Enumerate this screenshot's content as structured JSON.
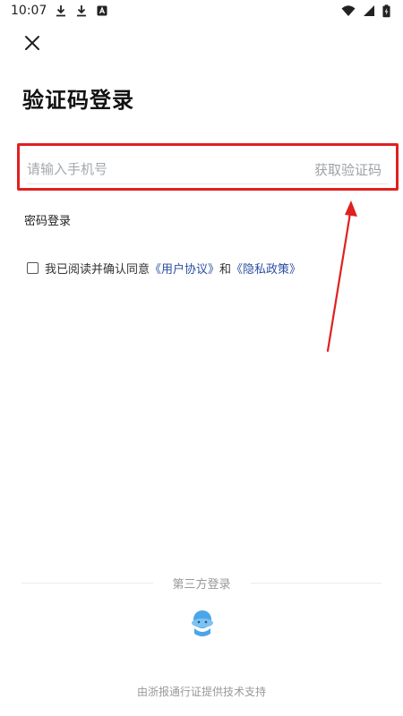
{
  "status_bar": {
    "time": "10:07",
    "icons": [
      "download-icon",
      "download-icon",
      "app-notification-icon",
      "wifi-icon",
      "signal-icon",
      "battery-charging-icon"
    ]
  },
  "header": {
    "close_icon": "close-icon",
    "title": "验证码登录"
  },
  "form": {
    "phone_placeholder": "请输入手机号",
    "phone_value": "",
    "get_code_label": "获取验证码",
    "password_login_label": "密码登录"
  },
  "agreement": {
    "checked": false,
    "prefix": "我已阅读并确认同意",
    "user_agreement": "《用户协议》",
    "conjunction": "和",
    "privacy_policy": "《隐私政策》"
  },
  "third_party": {
    "label": "第三方登录",
    "provider_icon": "mascot-icon"
  },
  "footer": {
    "text": "由浙报通行证提供技术支持"
  },
  "colors": {
    "highlight": "#e02020",
    "link": "#2b4fa0",
    "placeholder": "#a4a8ad",
    "mascot": "#4aa6e8"
  }
}
